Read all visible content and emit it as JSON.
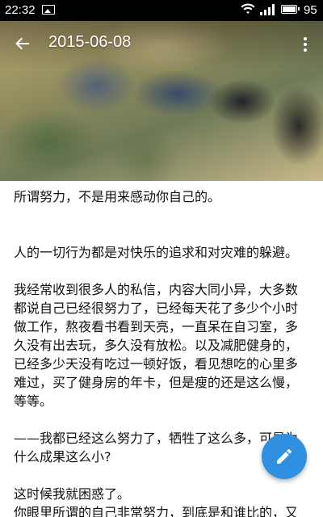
{
  "status_bar": {
    "time": "22:32",
    "battery_percent": "95",
    "icons": [
      "image-icon",
      "wifi-icon",
      "signal-icon",
      "battery-icon"
    ]
  },
  "toolbar": {
    "title": "2015-06-08",
    "back_icon": "arrow-left-icon",
    "more_icon": "more-vert-icon"
  },
  "article": {
    "paragraphs": [
      "所谓努力，不是用来感动你自己的。",
      "",
      "人的一切行为都是对快乐的追求和对灾难的躲避。",
      "我经常收到很多人的私信，内容大同小异，大多数都说自己已经很努力了，已经每天花了多少个小时做工作，熬夜看书看到天亮，一直呆在自习室，多久没有出去玩，多久没有放松。以及减肥健身的，已经多少天没有吃过一顿好饭，看见想吃的心里多难过，买了健身房的年卡，但是瘦的还是这么慢，等等。",
      "——我都已经这么努力了，牺牲了这么多，可是为什么成果这么小?",
      "这时候我就困惑了。",
      "你眼里所谓的自己非常努力，到底是和谁比的，又是做给谁看的?"
    ]
  },
  "fab": {
    "icon": "edit-pencil-icon",
    "color": "#2f8fe0"
  }
}
